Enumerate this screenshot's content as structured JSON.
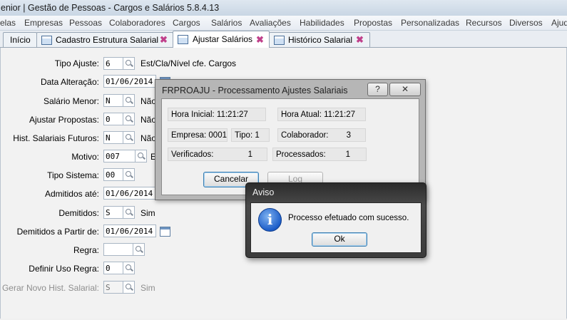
{
  "window": {
    "title": "enior | Gestão de Pessoas - Cargos e Salários 5.8.4.13"
  },
  "menu": [
    "elas",
    "Empresas",
    "Pessoas",
    "Colaboradores",
    "Cargos",
    "Salários",
    "Avaliações",
    "Habilidades",
    "Propostas",
    "Personalizadas",
    "Recursos",
    "Diversos",
    "Ajud"
  ],
  "tabs": [
    {
      "label": "Início"
    },
    {
      "label": "Cadastro Estrutura Salarial"
    },
    {
      "label": "Ajustar Salários"
    },
    {
      "label": "Histórico Salarial"
    }
  ],
  "form": {
    "tipo_ajuste": {
      "label": "Tipo Ajuste:",
      "value": "6",
      "desc": "Est/Cla/Nível cfe. Cargos"
    },
    "data_alteracao": {
      "label": "Data Alteração:",
      "value": "01/06/2014"
    },
    "salario_menor": {
      "label": "Salário Menor:",
      "value": "N",
      "desc": "Não"
    },
    "ajustar_propostas": {
      "label": "Ajustar Propostas:",
      "value": "0",
      "desc": "Não"
    },
    "hist_salariais_futuros": {
      "label": "Hist. Salariais Futuros:",
      "value": "N",
      "desc": "Não"
    },
    "motivo": {
      "label": "Motivo:",
      "value": "007",
      "desc": "E"
    },
    "tipo_sistema": {
      "label": "Tipo Sistema:",
      "value": "00"
    },
    "admitidos_ate": {
      "label": "Admitidos até:",
      "value": "01/06/2014"
    },
    "demitidos": {
      "label": "Demitidos:",
      "value": "S",
      "desc": "Sim"
    },
    "demitidos_a_partir": {
      "label": "Demitidos a Partir de:",
      "value": "01/06/2014"
    },
    "regra": {
      "label": "Regra:",
      "value": ""
    },
    "definir_uso_regra": {
      "label": "Definir Uso Regra:",
      "value": "0"
    },
    "gerar_novo_hist": {
      "label": "Gerar Novo Hist. Salarial:",
      "value": "S",
      "desc": "Sim"
    }
  },
  "process_dialog": {
    "title": "FRPROAJU - Processamento Ajustes Salariais",
    "help": "?",
    "close": "✕",
    "hora_inicial": "Hora Inicial: 11:21:27",
    "hora_atual": "Hora Atual: 11:21:27",
    "empresa": "Empresa: 0001",
    "tipo": "Tipo: 1",
    "colaborador_label": "Colaborador:",
    "colaborador_value": "3",
    "verificados_label": "Verificados:",
    "verificados_value": "1",
    "processados_label": "Processados:",
    "processados_value": "1",
    "cancel": "Cancelar",
    "log": "Log"
  },
  "alert_dialog": {
    "title": "Aviso",
    "icon": "info-icon",
    "message": "Processo efetuado com sucesso.",
    "ok": "Ok"
  }
}
